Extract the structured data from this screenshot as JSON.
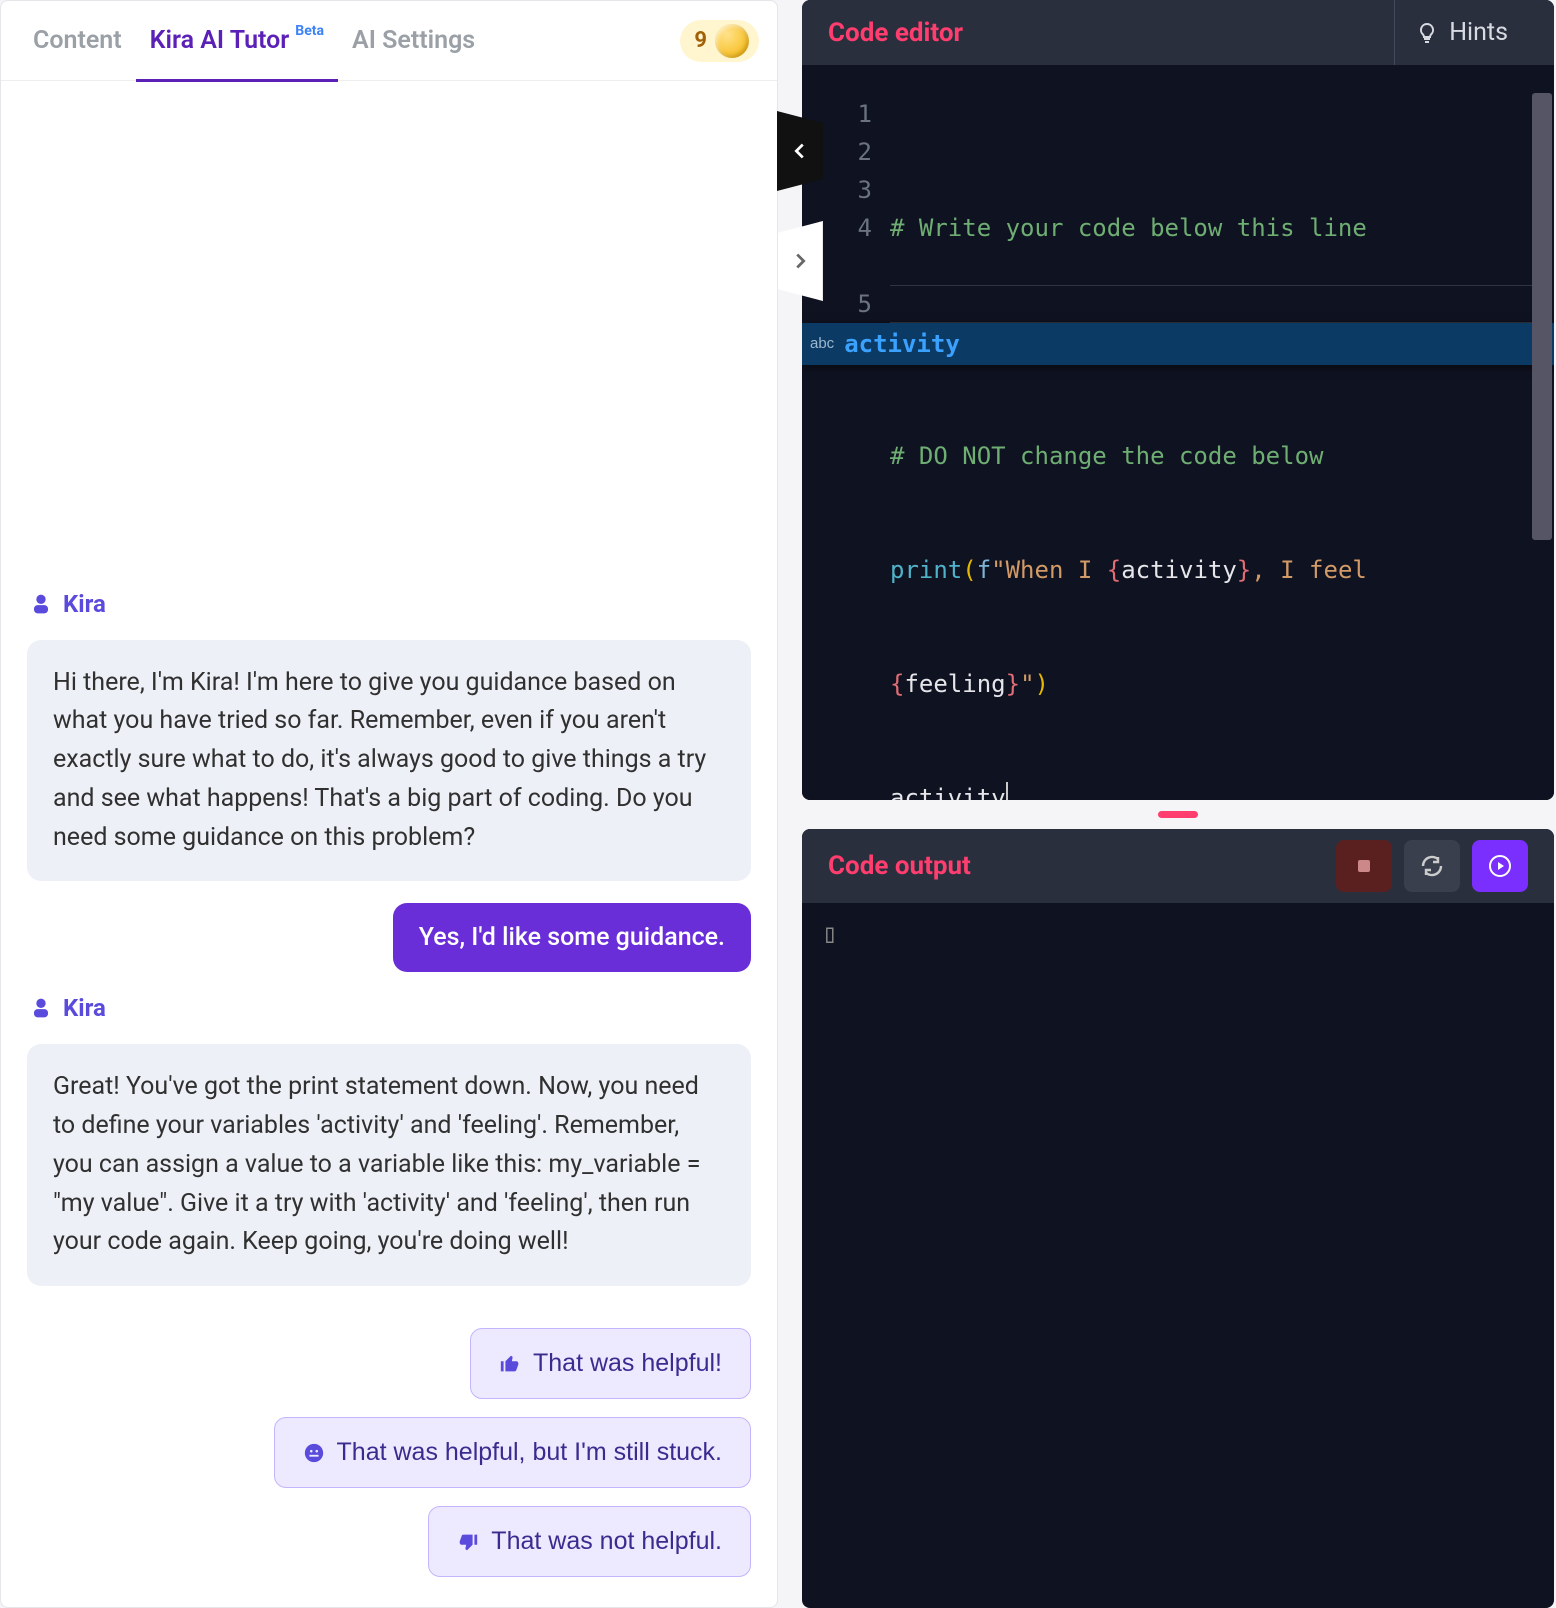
{
  "tabs": {
    "content": "Content",
    "tutor": "Kira AI Tutor",
    "tutor_badge": "Beta",
    "settings": "AI Settings"
  },
  "coin_count": "9",
  "chat": {
    "bot_name": "Kira",
    "msg1": "Hi there, I'm Kira! I'm here to give you guidance based on what you have tried so far. Remember, even if you aren't exactly sure what to do, it's always good to give things a try and see what happens! That's a big part of coding. Do you need some guidance on this problem?",
    "user1": "Yes, I'd like some guidance.",
    "msg2": "Great! You've got the print statement down. Now, you need to define your variables 'activity' and 'feeling'. Remember, you can assign a value to a variable like this: my_variable = \"my value\". Give it a try with 'activity' and 'feeling', then run your code again. Keep going, you're doing well!",
    "reply_helpful": "That was helpful!",
    "reply_stuck": "That was helpful, but I'm still stuck.",
    "reply_not": "That was not helpful."
  },
  "editor": {
    "title": "Code editor",
    "hints": "Hints",
    "lines": [
      "1",
      "2",
      "3",
      "4",
      "5"
    ],
    "l1_cmt": "# Write your code below this line",
    "l3_cmt": "# DO NOT change the code below",
    "l4_print": "print",
    "l4_open": "(",
    "l4_f": "f",
    "l4_s1": "\"When I ",
    "l4_b1o": "{",
    "l4_v1": "activity",
    "l4_b1c": "}",
    "l4_s2": ", I feel ",
    "l4_b2o": "{",
    "l4_v2": "feeling",
    "l4_b2c": "}",
    "l4_s3": "\"",
    "l4_close": ")",
    "l5": "activity",
    "ac_kind": "abc",
    "ac_text": "activity"
  },
  "output": {
    "title": "Code output",
    "placeholder": "▯"
  }
}
